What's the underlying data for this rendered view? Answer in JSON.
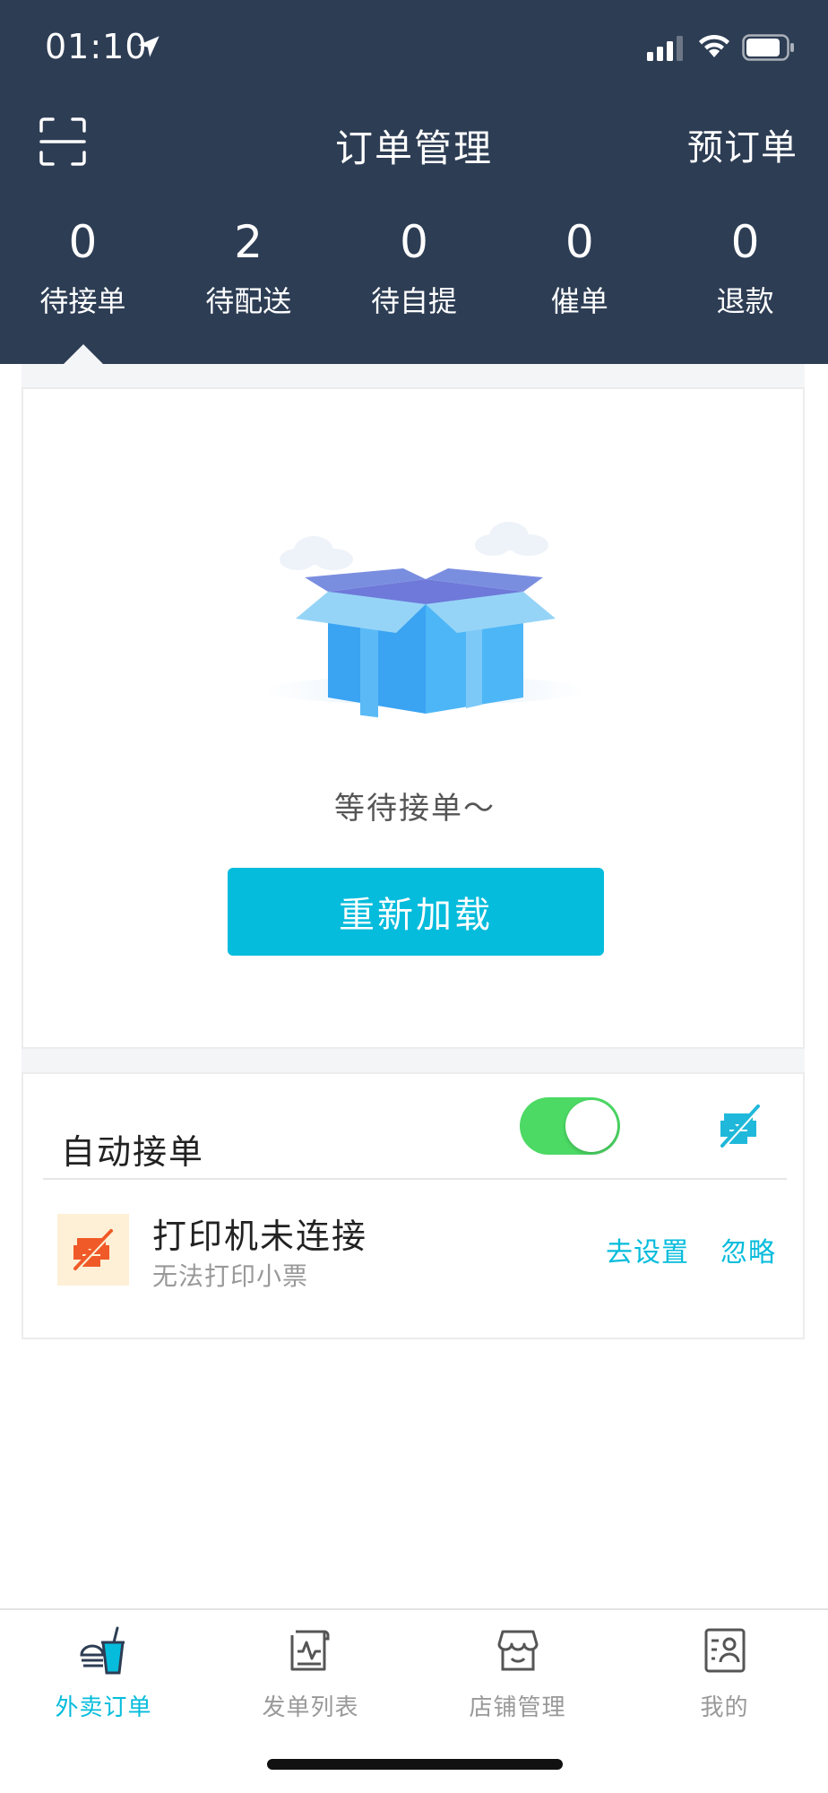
{
  "status_bar": {
    "time": "01:10"
  },
  "header": {
    "title": "订单管理",
    "preorder_label": "预订单"
  },
  "tabs": [
    {
      "count": "0",
      "label": "待接单"
    },
    {
      "count": "2",
      "label": "待配送"
    },
    {
      "count": "0",
      "label": "待自提"
    },
    {
      "count": "0",
      "label": "催单"
    },
    {
      "count": "0",
      "label": "退款"
    }
  ],
  "empty_state": {
    "message": "等待接单～",
    "reload_label": "重新加载"
  },
  "auto_accept": {
    "label": "自动接单",
    "enabled": true
  },
  "printer": {
    "title": "打印机未连接",
    "subtitle": "无法打印小票",
    "settings_label": "去设置",
    "ignore_label": "忽略"
  },
  "bottom_nav": [
    {
      "label": "外卖订单",
      "icon": "takeout-order-icon",
      "active": true
    },
    {
      "label": "发单列表",
      "icon": "dispatch-list-icon",
      "active": false
    },
    {
      "label": "店铺管理",
      "icon": "store-icon",
      "active": false
    },
    {
      "label": "我的",
      "icon": "profile-icon",
      "active": false
    }
  ],
  "colors": {
    "header_bg": "#2d3d54",
    "accent": "#06bcdc",
    "toggle_on": "#4cd964",
    "printer_warning": "#f05a28"
  }
}
